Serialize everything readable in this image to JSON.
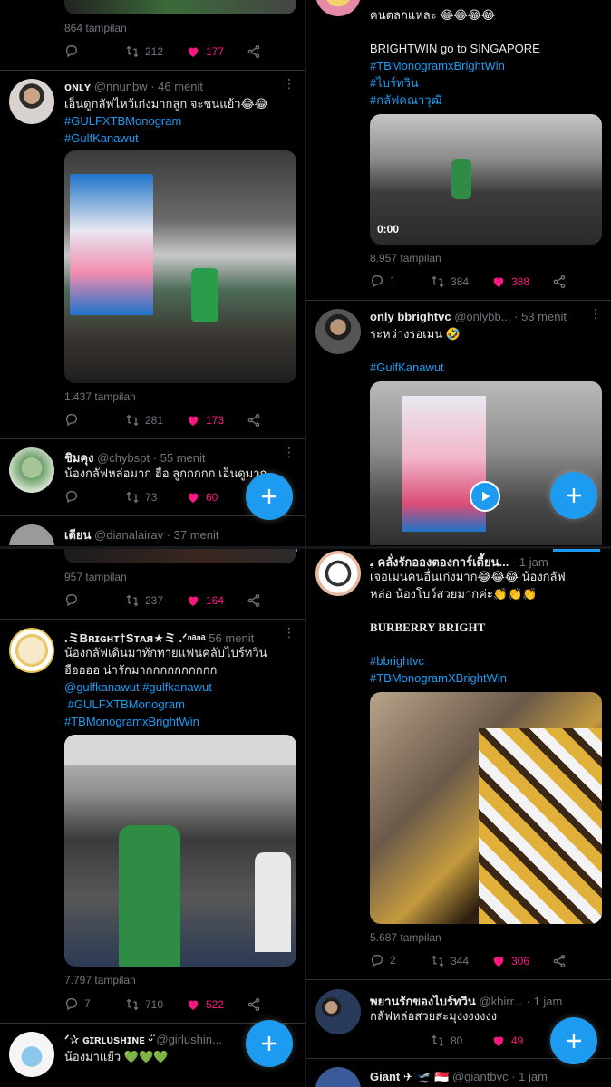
{
  "p1": {
    "tweet0": {
      "views": "864 tampilan",
      "replies": "",
      "retweets": "212",
      "likes": "177"
    },
    "tweet1": {
      "name": "ᴏɴʟʏ",
      "handle": "@nnunbw",
      "time": "· 46 menit",
      "text1": "เอ็นดูกลัฟไหว้เก่งมากลูก จะชนแย้ว😂😂",
      "tag1": "#GULFXTBMonogram",
      "tag2": "#GulfKanawut",
      "views": "1.437 tampilan",
      "retweets": "281",
      "likes": "173"
    },
    "tweet2": {
      "name": "ชิมคุง",
      "handle": "@chybspt",
      "time": "· 55 menit",
      "text1": "น้องกลัฟหล่อมาก ฮือ ลูกกกกก เอ็นดูมาก",
      "retweets": "73",
      "likes": "60"
    },
    "tweet3": {
      "name": "เดียน",
      "handle": "@dianalairav",
      "time": "· 37 menit"
    }
  },
  "p2": {
    "tweet0": {
      "views": "957 tampilan",
      "retweets": "237",
      "likes": "164"
    },
    "tweet1": {
      "name": ".ミBʀɪɢʜᴛ†Sᴛᴀя★ミ .ᐟⁿᵃⁿᵃ",
      "time": "56 menit",
      "text1": "น้องกลัฟเดินมาทักทายแฟนคลับไบร์ทวิน",
      "text2": "ฮืออออ น่ารักมากกกกกกกกกก",
      "tag1": "@gulfkanawut",
      "tag2": "#gulfkanawut",
      "tag3": "#GULFXTBMonogram",
      "tag4": "#TBMonogramxBrightWin",
      "views": "7.797 tampilan",
      "replies": "7",
      "retweets": "710",
      "likes": "522"
    },
    "tweet2": {
      "name": "ᐟ✰ ɢɪʀʟᴜsʜɪɴᴇ ᵕ̈",
      "handle": "@girlushin...",
      "time": "· 3",
      "text1": "น้องมาแย้ว 💚💚💚"
    }
  },
  "p3": {
    "tweet0": {
      "text_top": "คนตลกแหละ 😂😂😂😂",
      "text1": "BRIGHTWIN go to SINGAPORE",
      "tag1": "#TBMonogramxBrightWin",
      "tag2": "#ไบร์ทวิน",
      "tag3": "#กลัฟคณาวุฒิ",
      "duration": "0:00",
      "views": "8.957 tampilan",
      "replies": "1",
      "retweets": "384",
      "likes": "388"
    },
    "tweet1": {
      "name": "only bbrightvc",
      "handle": "@onlybb...",
      "time": "· 53 menit",
      "text1": "ระหว่างรอเมน 🤣",
      "tag1": "#GulfKanawut"
    }
  },
  "p4": {
    "tweet1": {
      "name": "ﯾ คลั่งรักอองตองการ์เดี้ยน...",
      "time": "· 1 jam",
      "text1": "เจอเมนคนอื่นเก่งมาก😂😂😂 น้องกลัฟ",
      "text2": "หล่อ น้องโบว์สวยมากค่ะ👏👏👏",
      "text3": "BURBERRY BRIGHT",
      "tag1": "#bbrightvc",
      "tag2": "#TBMonogramXBrightWin",
      "views": "5.687 tampilan",
      "replies": "2",
      "retweets": "344",
      "likes": "306"
    },
    "tweet2": {
      "name": "พยานรักของไบร์ทวิน",
      "handle": "@kbirr...",
      "time": "· 1 jam",
      "text1": "กลัฟหล่อสวยสะมุงงงงงงง",
      "retweets": "80",
      "likes": "49"
    },
    "tweet3": {
      "name": "Giant ✈ 🛫 🇸🇬",
      "handle": "@giantbvc",
      "time": "· 1 jam"
    }
  }
}
